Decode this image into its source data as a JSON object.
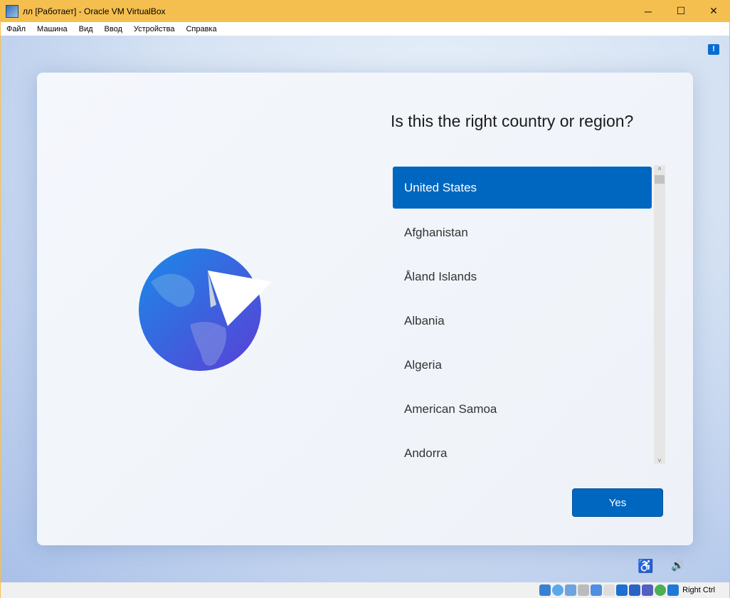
{
  "window": {
    "title": "лл [Работает] - Oracle VM VirtualBox",
    "minimize": "─",
    "maximize": "☐",
    "close": "✕"
  },
  "menu": [
    "Файл",
    "Машина",
    "Вид",
    "Ввод",
    "Устройства",
    "Справка"
  ],
  "setup": {
    "question": "Is this the right country or region?",
    "countries": [
      "United States",
      "Afghanistan",
      "Åland Islands",
      "Albania",
      "Algeria",
      "American Samoa",
      "Andorra"
    ],
    "selected": "United States",
    "yes_label": "Yes",
    "scroll_up": "˄",
    "scroll_down": "˅"
  },
  "feedback_icon": "!",
  "accessibility_icon": "♿",
  "volume_icon": "🔊",
  "status": {
    "host_key": "Right Ctrl"
  },
  "colors": {
    "accent": "#0067c0",
    "titlebar": "#f5bf4f"
  }
}
